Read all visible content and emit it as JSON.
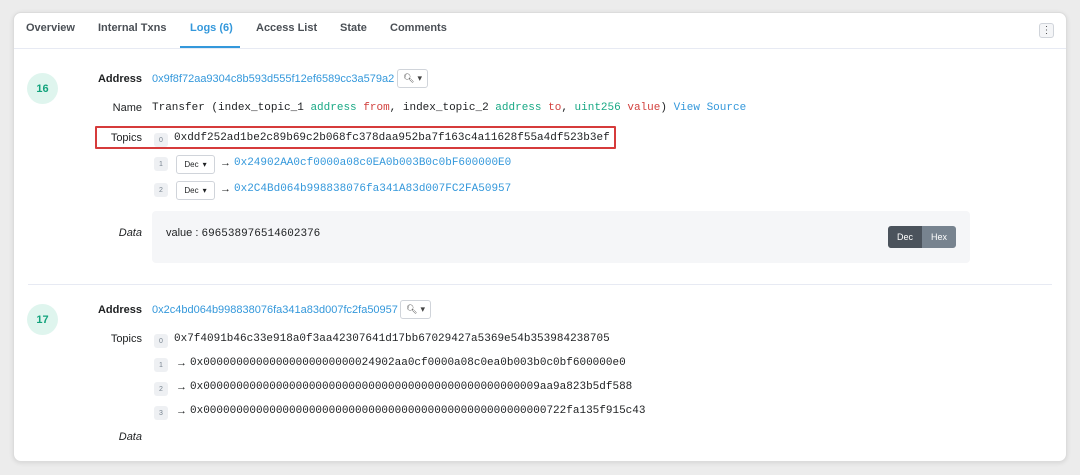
{
  "tabs": [
    {
      "label": "Overview"
    },
    {
      "label": "Internal Txns"
    },
    {
      "label": "Logs (6)"
    },
    {
      "label": "Access List"
    },
    {
      "label": "State"
    },
    {
      "label": "Comments"
    }
  ],
  "more_icon": "⋮",
  "labels": {
    "address": "Address",
    "name": "Name",
    "topics": "Topics",
    "data": "Data"
  },
  "logs": [
    {
      "index": "16",
      "address": "0x9f8f72aa9304c8b593d555f12ef6589cc3a579a2",
      "name": {
        "fn": "Transfer",
        "p1_prefix": " (index_topic_1 ",
        "p1_type": "address",
        "p1_name": "from",
        "p2_prefix": ", index_topic_2 ",
        "p2_type": "address",
        "p2_name": "to",
        "p3_type": "uint256",
        "p3_name": "value",
        "view_source": "View Source"
      },
      "topics": [
        {
          "idx": "0",
          "value": "0xddf252ad1be2c89b69c2b068fc378daa952ba7f163c4a11628f55a4df523b3ef"
        },
        {
          "idx": "1",
          "select": "Dec",
          "arrow": "→",
          "value": "0x24902AA0cf0000a08c0EA0b003B0c0bF600000E0"
        },
        {
          "idx": "2",
          "select": "Dec",
          "arrow": "→",
          "value": "0x2C4Bd064b998838076fa341A83d007FC2FA50957"
        }
      ],
      "data": {
        "key": "value : ",
        "value": "696538976514602376",
        "dec_label": "Dec",
        "hex_label": "Hex"
      }
    },
    {
      "index": "17",
      "address": "0x2c4bd064b998838076fa341a83d007fc2fa50957",
      "topics": [
        {
          "idx": "0",
          "value": "0x7f4091b46c33e918a0f3aa42307641d17bb67029427a5369e54b353984238705"
        },
        {
          "idx": "1",
          "arrow": "→",
          "value": "0x00000000000000000000000024902aa0cf0000a08c0ea0b003b0c0bf600000e0"
        },
        {
          "idx": "2",
          "arrow": "→",
          "value": "0x000000000000000000000000000000000000000000000000009aa9a823b5df588"
        },
        {
          "idx": "3",
          "arrow": "→",
          "value": "0x0000000000000000000000000000000000000000000000000000722fa135f915c43"
        }
      ]
    }
  ],
  "icons": {
    "search": "🔍︎",
    "chevron": "▾"
  },
  "colors": {
    "accent": "#3498db",
    "index_bg": "#dff5ee",
    "index_fg": "#12a37c",
    "highlight": "#d63b3b",
    "type_green": "#17a884",
    "param_red": "#d2413e"
  }
}
